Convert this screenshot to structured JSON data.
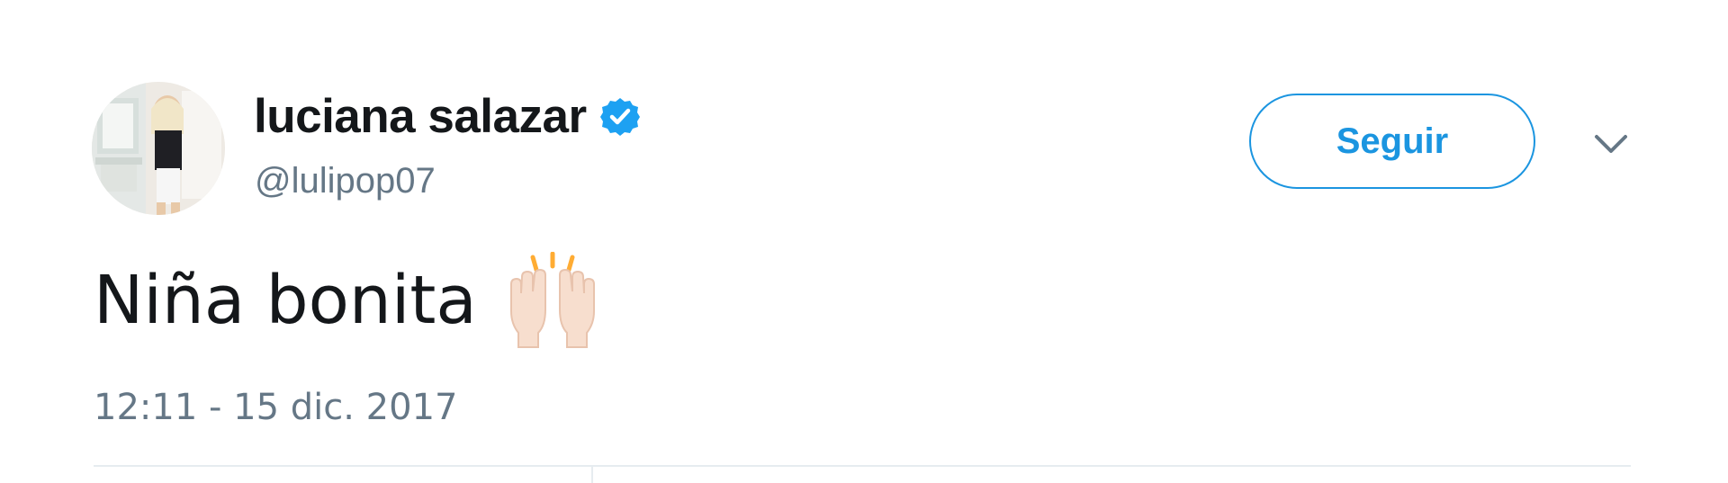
{
  "user": {
    "display_name": "luciana salazar",
    "handle": "@lulipop07",
    "verified": true,
    "avatar_alt": "profile photo"
  },
  "actions": {
    "follow_label": "Seguir",
    "more_icon": "chevron-down-icon"
  },
  "tweet": {
    "text": "Niña bonita",
    "emoji": "raising-hands-emoji",
    "timestamp": "12:11 - 15 dic. 2017"
  },
  "colors": {
    "accent": "#1b95e0",
    "verified_blue": "#1da1f2",
    "text_primary": "#14171a",
    "text_secondary": "#657786",
    "divider": "#e6ecf0"
  }
}
